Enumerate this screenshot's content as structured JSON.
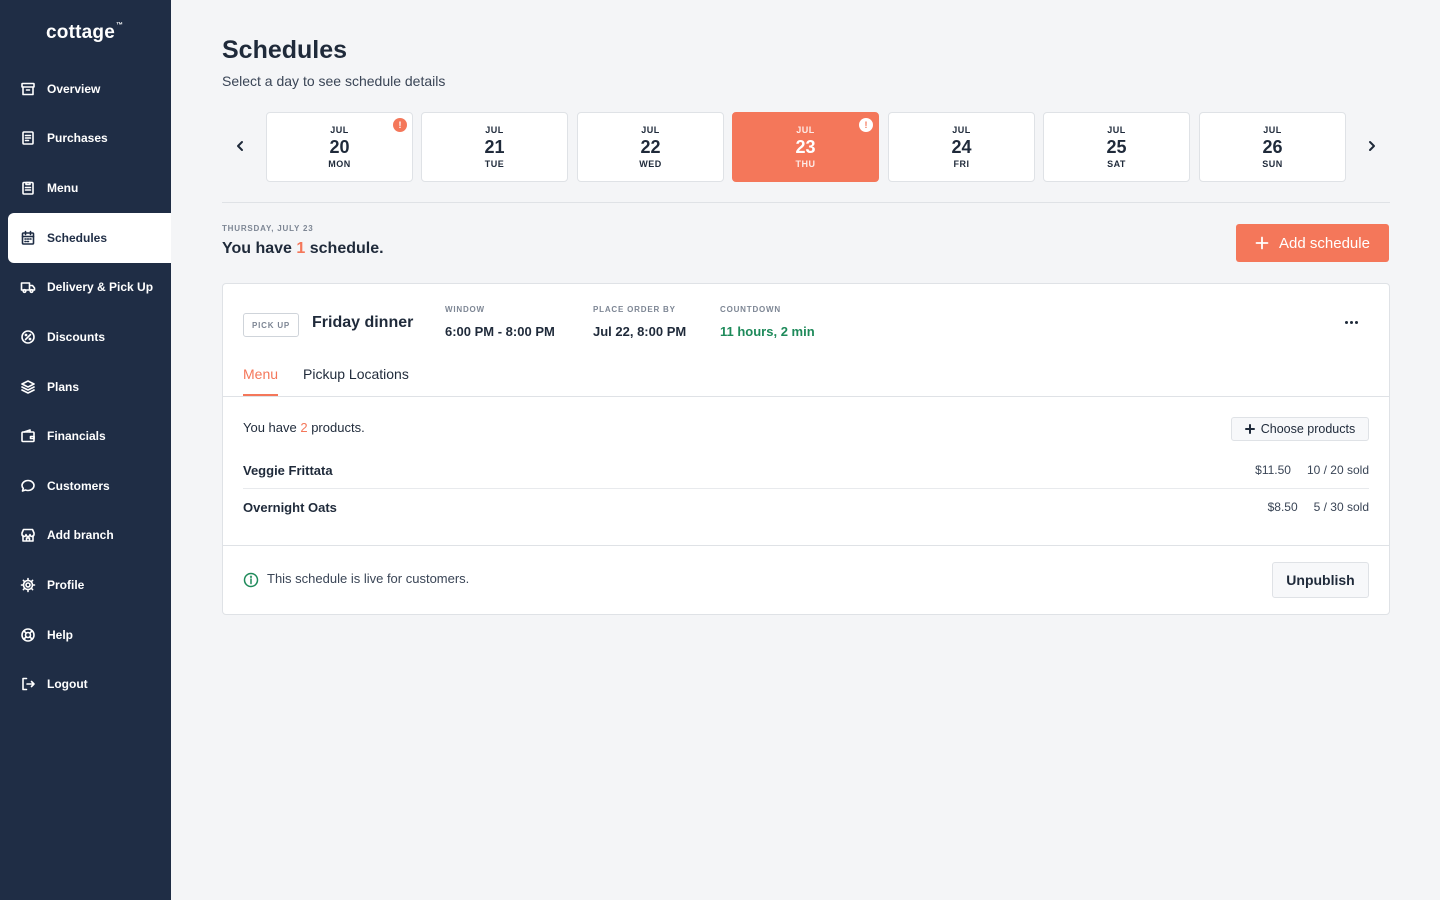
{
  "app": {
    "logo": "cottage",
    "logo_mark": "™"
  },
  "sidebar": {
    "items": [
      {
        "label": "Overview",
        "icon": "archive-icon"
      },
      {
        "label": "Purchases",
        "icon": "receipt-icon"
      },
      {
        "label": "Menu",
        "icon": "clipboard-icon"
      },
      {
        "label": "Schedules",
        "icon": "calendar-icon",
        "active": true
      },
      {
        "label": "Delivery & Pick Up",
        "icon": "truck-icon"
      },
      {
        "label": "Discounts",
        "icon": "percent-icon"
      },
      {
        "label": "Plans",
        "icon": "layers-icon"
      },
      {
        "label": "Financials",
        "icon": "wallet-icon"
      },
      {
        "label": "Customers",
        "icon": "chat-bubble-icon"
      },
      {
        "label": "Add branch",
        "icon": "store-icon"
      },
      {
        "label": "Profile",
        "icon": "gear-icon"
      },
      {
        "label": "Help",
        "icon": "lifebuoy-icon"
      },
      {
        "label": "Logout",
        "icon": "logout-icon"
      }
    ]
  },
  "header": {
    "title": "Schedules",
    "subtitle": "Select a day to see schedule details"
  },
  "days": [
    {
      "month": "JUL",
      "day": "20",
      "weekday": "MON",
      "badge": "!"
    },
    {
      "month": "JUL",
      "day": "21",
      "weekday": "TUE"
    },
    {
      "month": "JUL",
      "day": "22",
      "weekday": "WED"
    },
    {
      "month": "JUL",
      "day": "23",
      "weekday": "THU",
      "badge": "!",
      "selected": true
    },
    {
      "month": "JUL",
      "day": "24",
      "weekday": "FRI"
    },
    {
      "month": "JUL",
      "day": "25",
      "weekday": "SAT"
    },
    {
      "month": "JUL",
      "day": "26",
      "weekday": "SUN"
    }
  ],
  "day_summary": {
    "date_label": "THURSDAY, JULY 23",
    "prefix": "You have ",
    "count": "1",
    "suffix": " schedule.",
    "add_button": "Add schedule"
  },
  "schedule": {
    "type": "PICK UP",
    "name": "Friday dinner",
    "window_label": "WINDOW",
    "window_value": "6:00 PM - 8:00 PM",
    "order_by_label": "PLACE ORDER BY",
    "order_by_value": "Jul 22, 8:00 PM",
    "countdown_label": "COUNTDOWN",
    "countdown_value": "11 hours, 2 min",
    "tabs": [
      "Menu",
      "Pickup Locations"
    ],
    "products_prefix": "You have ",
    "products_count": "2",
    "products_suffix": " products.",
    "choose_button": "Choose products",
    "products": [
      {
        "name": "Veggie Frittata",
        "price": "$11.50",
        "sold": "10 / 20 sold"
      },
      {
        "name": "Overnight Oats",
        "price": "$8.50",
        "sold": "5 / 30 sold"
      }
    ],
    "live_text": "This schedule is live for customers.",
    "unpublish_button": "Unpublish"
  },
  "colors": {
    "accent": "#f4775a",
    "sidebar": "#1f2d45",
    "success": "#1e8a5a"
  }
}
